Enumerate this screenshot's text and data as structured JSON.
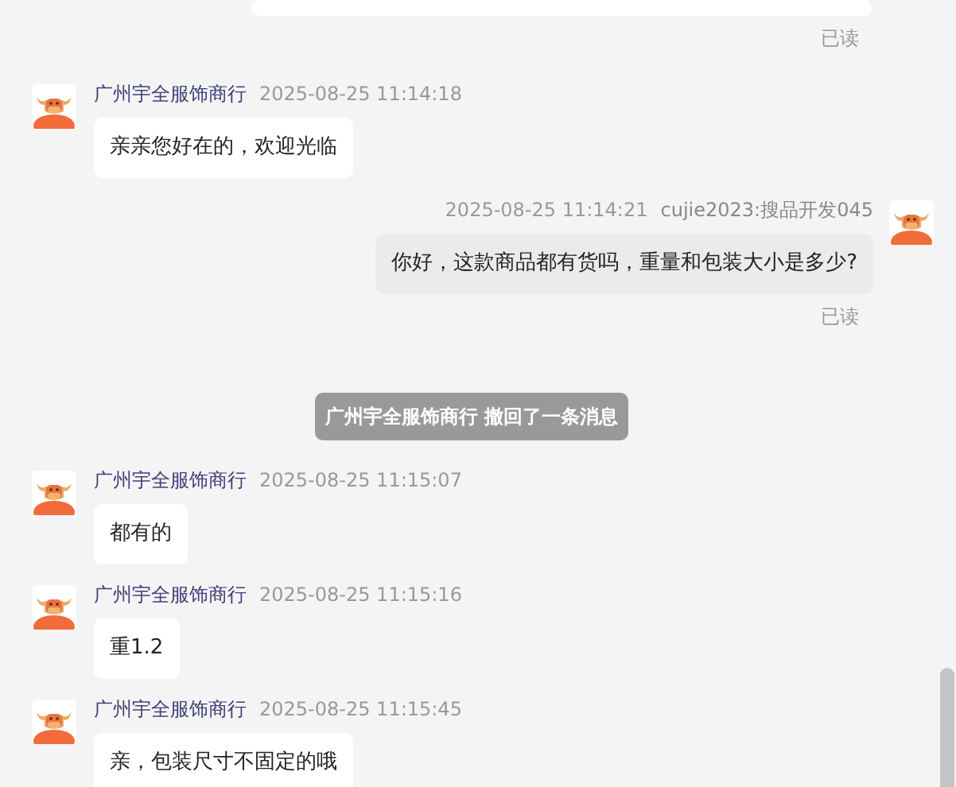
{
  "messages": [
    {
      "kind": "clipped"
    },
    {
      "kind": "read",
      "text": "已读"
    },
    {
      "kind": "incoming",
      "sender": "广州宇全服饰商行",
      "time": "2025-08-25 11:14:18",
      "text": "亲亲您好在的，欢迎光临"
    },
    {
      "kind": "outgoing",
      "sender": "cujie2023:搜品开发045",
      "time": "2025-08-25 11:14:21",
      "text": "你好，这款商品都有货吗，重量和包装大小是多少?"
    },
    {
      "kind": "read",
      "text": "已读"
    },
    {
      "kind": "notice",
      "text": "广州宇全服饰商行 撤回了一条消息"
    },
    {
      "kind": "incoming",
      "sender": "广州宇全服饰商行",
      "time": "2025-08-25 11:15:07",
      "text": "都有的"
    },
    {
      "kind": "incoming",
      "sender": "广州宇全服饰商行",
      "time": "2025-08-25 11:15:16",
      "text": "重1.2"
    },
    {
      "kind": "incoming",
      "sender": "广州宇全服饰商行",
      "time": "2025-08-25 11:15:45",
      "text": "亲，包装尺寸不固定的哦"
    }
  ]
}
